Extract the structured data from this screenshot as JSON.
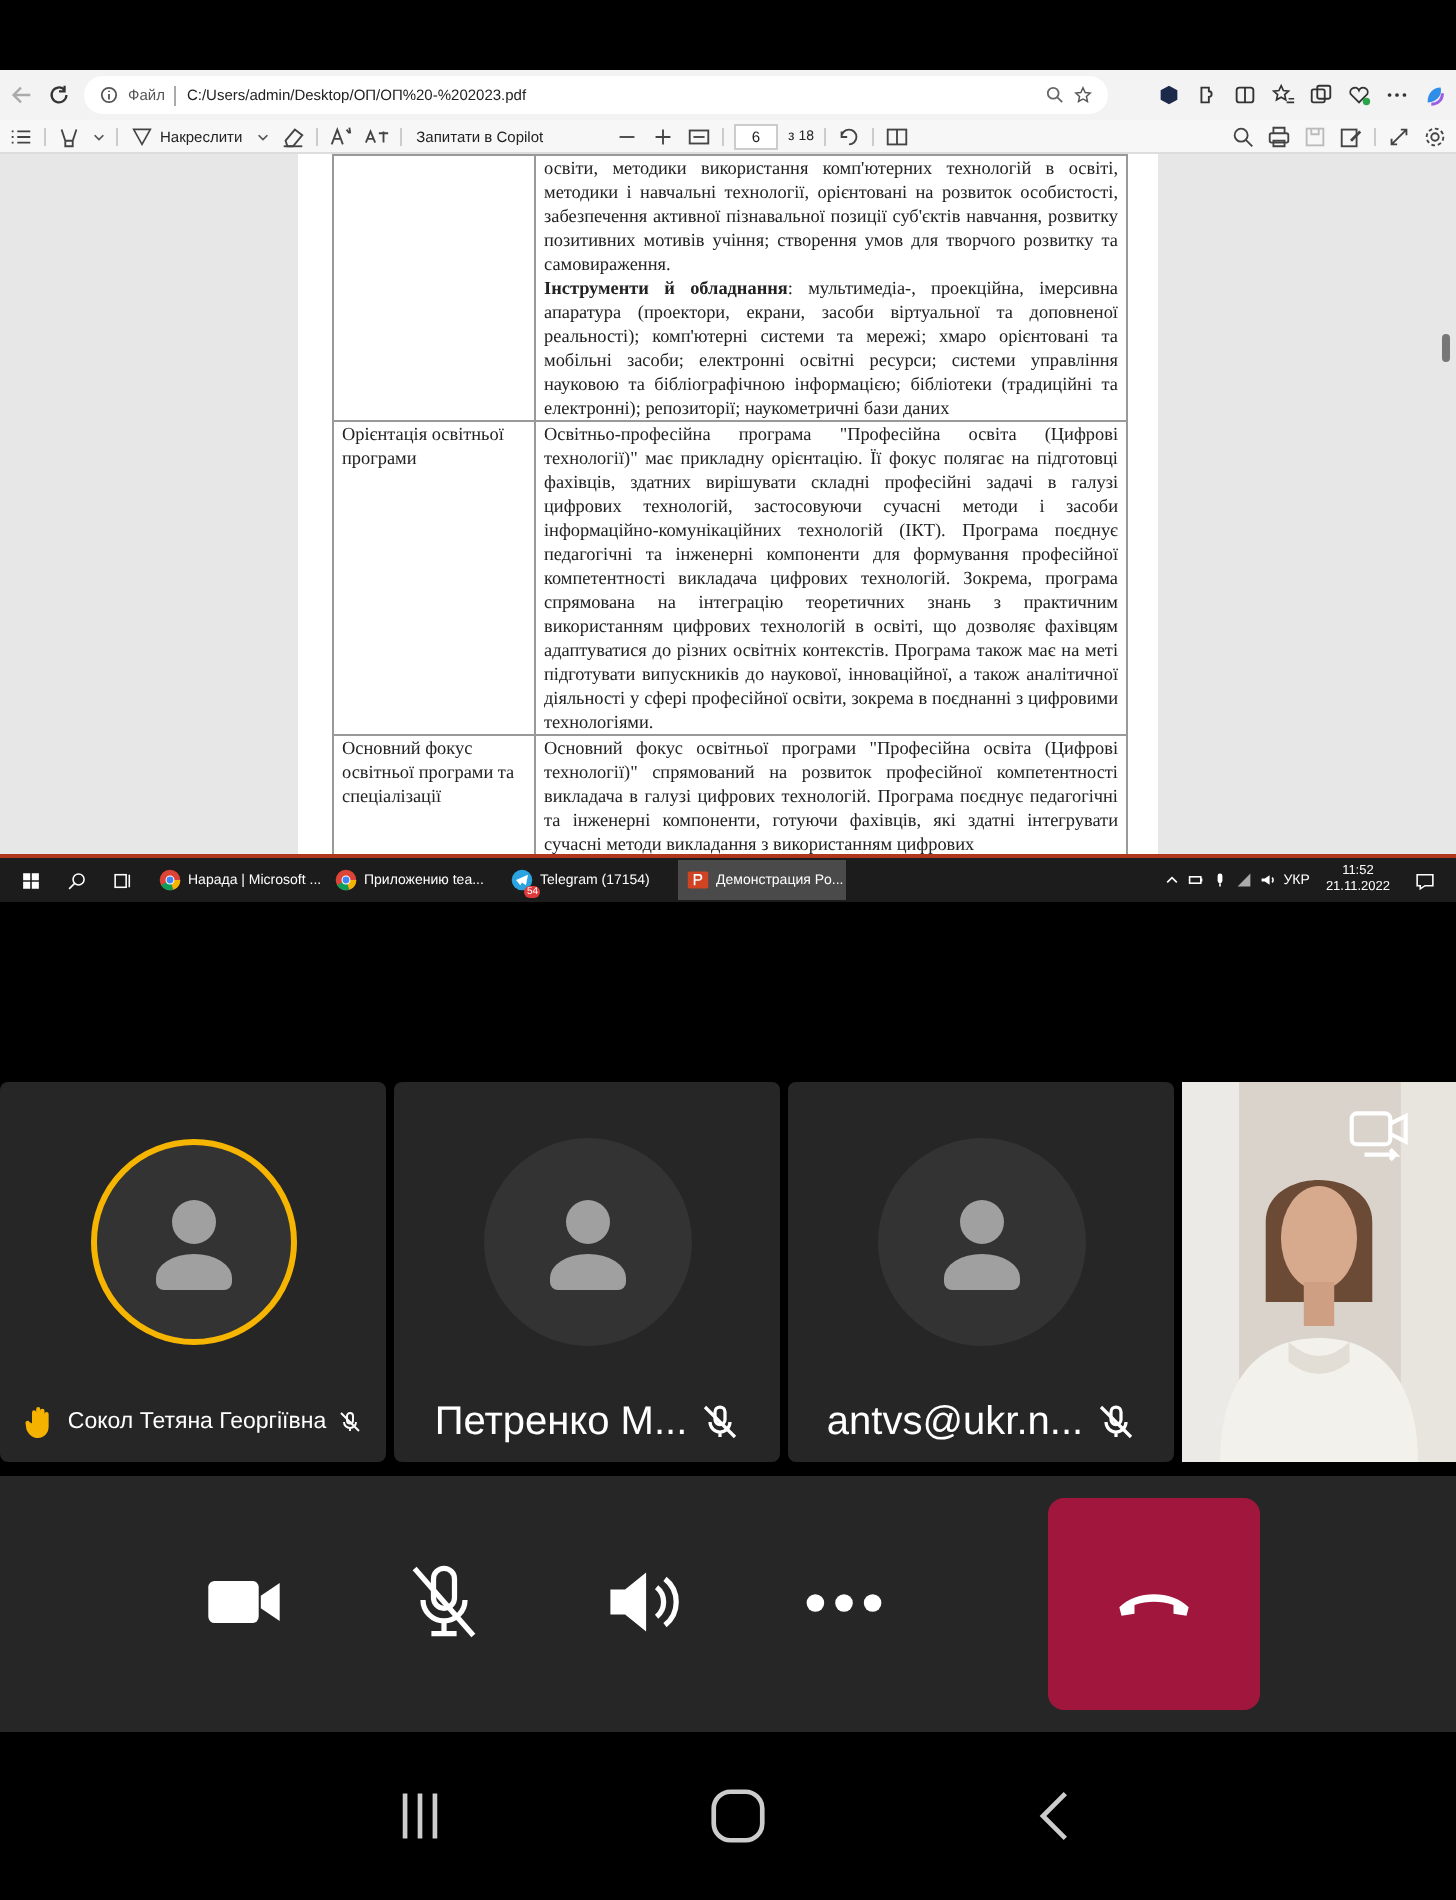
{
  "browser": {
    "file_label": "Файл",
    "url": "C:/Users/admin/Desktop/ОП/ОП%20-%202023.pdf"
  },
  "pdf_toolbar": {
    "draw_label": "Накреслити",
    "copilot_label": "Запитати в Copilot",
    "page": "6",
    "page_total": "з 18"
  },
  "document": {
    "rows": [
      {
        "paragraphs": [
          "освіти, методики використання комп'ютерних технологій в освіті, методики і навчальні технології, орієнтовані на розвиток особистості, забезпечення активної пізнавальної позиції суб'єктів навчання, розвитку позитивних мотивів учіння; створення умов для творчого розвитку та самовираження.",
          "**Інструменти й обладнання**: мультимедіа-, проекційна, імерсивна апаратура (проектори, екрани, засоби віртуальної та доповненої реальності); комп'ютерні системи та мережі; хмаро орієнтовані та мобільні засоби; електронні освітні ресурси; системи управління науковою та бібліографічною інформацією; бібліотеки (традиційні та електронні); репозиторії; наукометричні бази даних"
        ]
      },
      {
        "label": "Орієнтація освітньої програми",
        "paragraphs": [
          "Освітньо-професійна програма \"Професійна освіта (Цифрові технології)\" має прикладну орієнтацію. Її фокус полягає на підготовці фахівців, здатних вирішувати складні професійні задачі в галузі цифрових технологій, застосовуючи сучасні методи і засоби інформаційно-комунікаційних технологій (ІКТ). Програма поєднує педагогічні та інженерні компоненти для формування професійної компетентності викладача цифрових технологій. Зокрема, програма спрямована на інтеграцію теоретичних знань з практичним використанням цифрових технологій в освіті, що дозволяє фахівцям адаптуватися до різних освітніх контекстів. Програма також має на меті підготувати випускників до наукової, інноваційної, а також аналітичної діяльності у сфері професійної освіти, зокрема в поєднанні з цифровими технологіями."
        ]
      },
      {
        "label": "Основний фокус освітньої програми та спеціалізації",
        "paragraphs": [
          "Основний фокус освітньої програми \"Професійна освіта (Цифрові технології)\" спрямований на розвиток професійної компетентності викладача в галузі цифрових технологій. Програма поєднує педагогічні та інженерні компоненти, готуючи фахівців, які здатні інтегрувати сучасні методи викладання з використанням цифрових"
        ]
      }
    ]
  },
  "taskbar": {
    "apps": [
      {
        "kind": "chrome",
        "label": "Нарада | Microsoft ...",
        "selected": false
      },
      {
        "kind": "chrome",
        "label": "Приложению tea...",
        "selected": false
      },
      {
        "kind": "telegram",
        "label": "Telegram (17154)",
        "badge": "54",
        "selected": false
      },
      {
        "kind": "powerpoint",
        "label": "Демонстрация Po...",
        "selected": true
      }
    ],
    "language": "УКР",
    "time": "11:52",
    "date": "21.11.2022"
  },
  "participants": [
    {
      "kind": "avatar",
      "name": "Сокол Тетяна Георгіївна",
      "speaking": true,
      "hand_raised": true,
      "muted": true
    },
    {
      "kind": "avatar",
      "name": "Петренко М...",
      "speaking": false,
      "hand_raised": false,
      "muted": true
    },
    {
      "kind": "avatar",
      "name": "antvs@ukr.n...",
      "speaking": false,
      "hand_raised": false,
      "muted": true
    },
    {
      "kind": "video"
    }
  ],
  "controls": {
    "mic_muted": true
  }
}
